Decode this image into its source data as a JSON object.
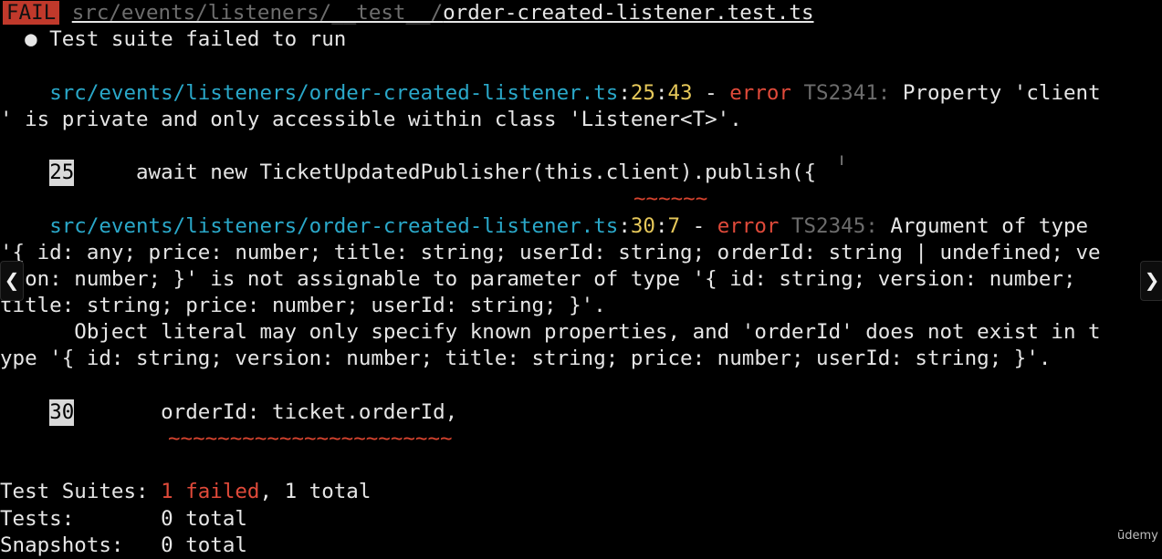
{
  "header": {
    "status": "FAIL",
    "path_dir": "src/events/listeners/__test__/",
    "path_file": "order-created-listener.test.ts"
  },
  "suite_message": "● Test suite failed to run",
  "errors": [
    {
      "file": "src/events/listeners/order-created-listener.ts",
      "line": "25",
      "col": "43",
      "level": "error",
      "code": "TS2341:",
      "message_1": " Property 'client",
      "message_2": "' is private and only accessible within class 'Listener<T>'.",
      "code_line_number": "25",
      "code_line": "     await new TicketUpdatedPublisher(this.client).publish({",
      "squiggle": "~~~~~~"
    },
    {
      "file": "src/events/listeners/order-created-listener.ts",
      "line": "30",
      "col": "7",
      "level": "error",
      "code": "TS2345:",
      "message_1": " Argument of type",
      "message_2": "'{ id: any; price: number; title: string; userId: string; orderId: string | undefined; ve",
      "message_3": "sion: number; }' is not assignable to parameter of type '{ id: string; version: number;",
      "message_4": "title: string; price: number; userId: string; }'.",
      "message_5": "      Object literal may only specify known properties, and 'orderId' does not exist in t",
      "message_6": "ype '{ id: string; version: number; title: string; price: number; userId: string; }'.",
      "code_line_number": "30",
      "code_line": "       orderId: ticket.orderId,",
      "squiggle": "~~~~~~~~~~~~~~~~~~~~~~~"
    }
  ],
  "summary": {
    "suites_label": "Test Suites: ",
    "suites_failed": "1 failed",
    "suites_total": ", 1 total",
    "tests_label": "Tests:       ",
    "tests_total": "0 total",
    "snapshots_label": "Snapshots:   ",
    "snapshots_total": "0 total"
  },
  "watermark": "ūdemy",
  "nav": {
    "prev_icon": "chevron-left-icon",
    "next_icon": "chevron-right-icon"
  }
}
